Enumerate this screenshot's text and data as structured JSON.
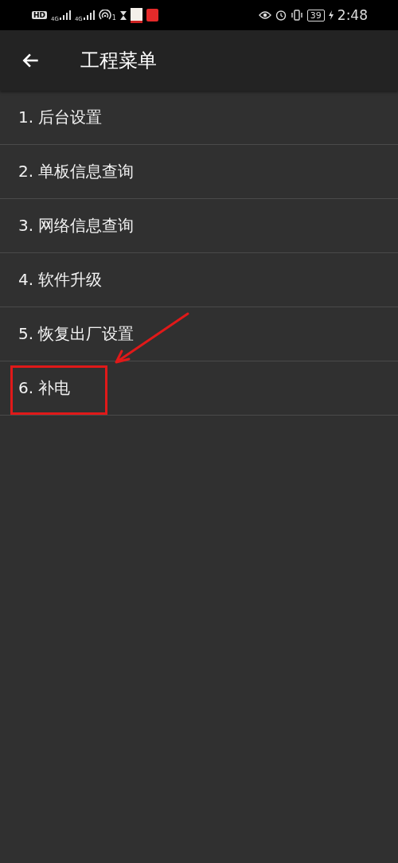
{
  "status_bar": {
    "hd": "HD",
    "network_1": "4G",
    "network_2": "4G",
    "hotspot_count": "1",
    "battery": "39",
    "time": "2:48"
  },
  "app_bar": {
    "title": "工程菜单"
  },
  "menu_items": [
    {
      "label": "1. 后台设置",
      "annotated": false
    },
    {
      "label": "2. 单板信息查询",
      "annotated": false
    },
    {
      "label": "3. 网络信息查询",
      "annotated": false
    },
    {
      "label": "4. 软件升级",
      "annotated": false
    },
    {
      "label": "5. 恢复出厂设置",
      "annotated": false
    },
    {
      "label": "6. 补电",
      "annotated": true
    }
  ]
}
